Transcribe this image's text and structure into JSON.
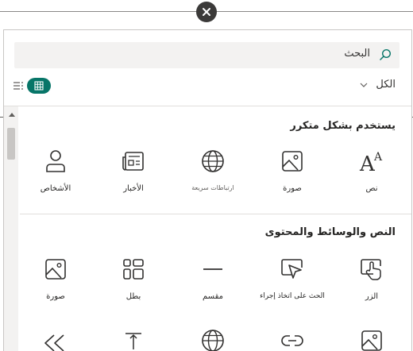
{
  "search": {
    "text": "البحث"
  },
  "filter": {
    "label": "الكل"
  },
  "sections": [
    {
      "title": "يستخدم بشكل متكرر",
      "items": [
        {
          "label": "نص",
          "icon": "text-icon"
        },
        {
          "label": "صورة",
          "icon": "image-icon"
        },
        {
          "label": "ارتباطات سريعة",
          "icon": "globe-icon"
        },
        {
          "label": "الأخبار",
          "icon": "news-icon"
        },
        {
          "label": "الأشخاص",
          "icon": "person-icon"
        }
      ]
    },
    {
      "title": "النص والوسائط والمحتوى",
      "items": [
        {
          "label": "الزر",
          "icon": "button-icon"
        },
        {
          "label": "الحث على اتخاذ إجراء",
          "icon": "call-to-action-icon"
        },
        {
          "label": "مقسم",
          "icon": "divider-icon"
        },
        {
          "label": "بطل",
          "icon": "hero-icon"
        },
        {
          "label": "صورة",
          "icon": "image-icon"
        }
      ]
    }
  ],
  "colors": {
    "accent": "#077568",
    "close": "#3b3a39",
    "search_bg": "#f3f2f1"
  }
}
